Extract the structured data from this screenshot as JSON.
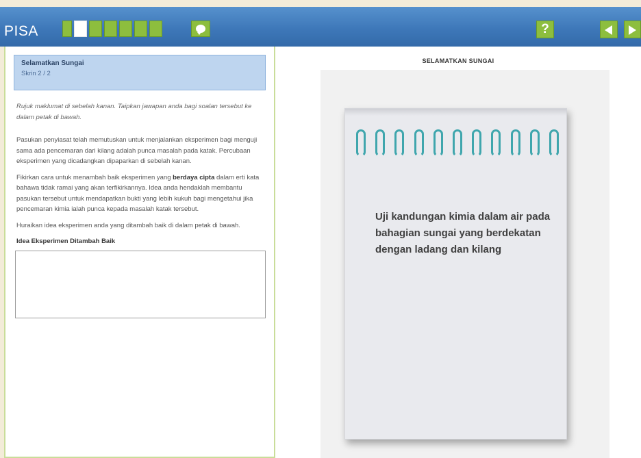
{
  "header": {
    "logo_text": "PISA",
    "progress": {
      "total_segments": 7,
      "current_segment": 2
    },
    "help_label": "?",
    "colors": {
      "bar": "#3e78b9",
      "button": "#8dbe3e"
    },
    "icons": [
      "chat-icon",
      "help-icon",
      "arrow-left-icon",
      "arrow-right-icon"
    ]
  },
  "unit": {
    "title": "Selamatkan Sungai",
    "screen": "Skrin 2 / 2"
  },
  "left": {
    "instruction": "Rujuk maklumat di sebelah kanan. Taipkan jawapan anda bagi soalan tersebut ke dalam petak di bawah.",
    "p1": "Pasukan penyiasat telah memutuskan untuk menjalankan eksperimen bagi menguji sama ada pencemaran dari kilang adalah punca masalah pada katak. Percubaan eksperimen yang dicadangkan dipaparkan di sebelah kanan.",
    "p2_pre": "Fikirkan cara untuk menambah baik eksperimen yang ",
    "p2_bold": "berdaya cipta",
    "p2_post": " dalam erti kata bahawa tidak ramai yang akan terfikirkannya. Idea anda hendaklah membantu pasukan tersebut untuk mendapatkan bukti yang lebih kukuh bagi mengetahui jika pencemaran kimia ialah punca kepada masalah katak tersebut.",
    "p3": "Huraikan idea eksperimen anda yang ditambah baik di dalam petak di bawah.",
    "answer_label": "Idea Eksperimen Ditambah Baik",
    "answer_value": ""
  },
  "right": {
    "title": "SELAMATKAN SUNGAI",
    "note_text": "Uji kandungan kimia dalam air pada bahagian sungai yang berdekatan dengan ladang dan kilang",
    "spiral_color": "#3fa6ad",
    "spiral_count": 11
  }
}
